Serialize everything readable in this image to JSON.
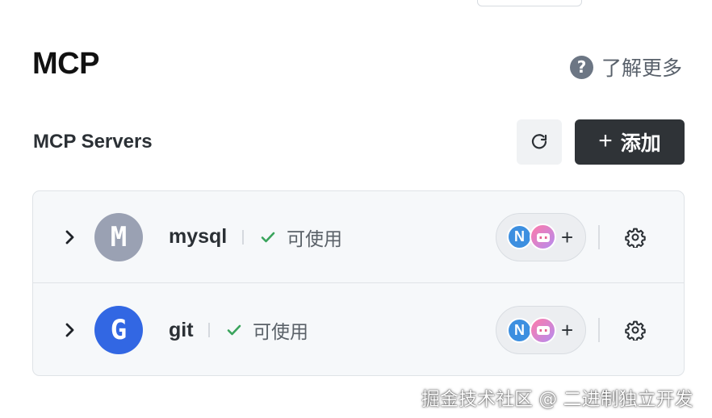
{
  "header": {
    "title": "MCP",
    "learn_more_label": "了解更多",
    "help_icon": "?"
  },
  "section": {
    "title": "MCP Servers",
    "add_button_label": "添加",
    "add_button_icon": "+"
  },
  "servers": [
    {
      "name": "mysql",
      "avatar_letter": "M",
      "avatar_color": "#9aa1b3",
      "status": "可使用",
      "status_color": "#3aa45c",
      "agent_letter": "N",
      "agent_add": "+"
    },
    {
      "name": "git",
      "avatar_letter": "G",
      "avatar_color": "#3267e3",
      "status": "可使用",
      "status_color": "#3aa45c",
      "agent_letter": "N",
      "agent_add": "+"
    }
  ],
  "watermark": "掘金技术社区 @ 二进制独立开发",
  "colors": {
    "primary_button": "#2f3337",
    "secondary_button": "#f0f2f4",
    "list_background": "#f6f8fa",
    "border": "#dfe3e7"
  }
}
